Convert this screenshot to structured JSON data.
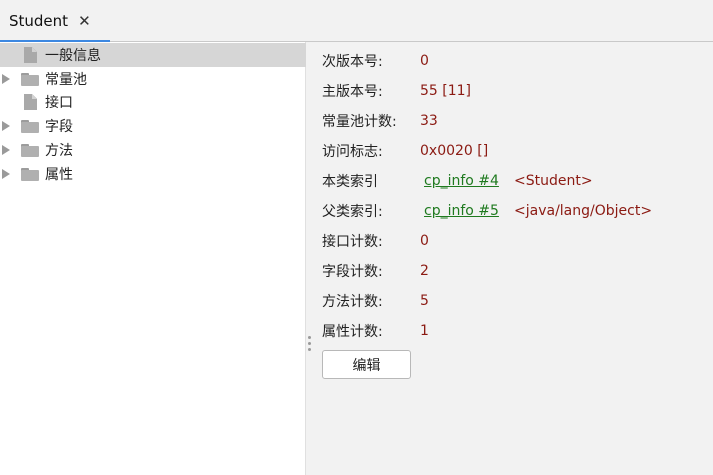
{
  "tab": {
    "title": "Student",
    "close_glyph": "✕"
  },
  "tree": {
    "items": [
      {
        "label": "一般信息",
        "icon": "file-icon",
        "expandable": false,
        "selected": true
      },
      {
        "label": "常量池",
        "icon": "folder-icon",
        "expandable": true,
        "selected": false
      },
      {
        "label": "接口",
        "icon": "file-icon",
        "expandable": false,
        "selected": false
      },
      {
        "label": "字段",
        "icon": "folder-icon",
        "expandable": true,
        "selected": false
      },
      {
        "label": "方法",
        "icon": "folder-icon",
        "expandable": true,
        "selected": false
      },
      {
        "label": "属性",
        "icon": "folder-icon",
        "expandable": true,
        "selected": false
      }
    ]
  },
  "details": {
    "minor_version": {
      "label": "次版本号:",
      "value": "0"
    },
    "major_version": {
      "label": "主版本号:",
      "value": "55 [11]"
    },
    "constant_pool_count": {
      "label": "常量池计数:",
      "value": "33"
    },
    "access_flags": {
      "label": "访问标志:",
      "value": "0x0020 []"
    },
    "this_class": {
      "label": "本类索引",
      "link": "cp_info #4",
      "ref": "<Student>"
    },
    "super_class": {
      "label": "父类索引:",
      "link": "cp_info #5",
      "ref": "<java/lang/Object>"
    },
    "interfaces_count": {
      "label": "接口计数:",
      "value": "0"
    },
    "fields_count": {
      "label": "字段计数:",
      "value": "2"
    },
    "methods_count": {
      "label": "方法计数:",
      "value": "5"
    },
    "attributes_count": {
      "label": "属性计数:",
      "value": "1"
    }
  },
  "edit_button": {
    "label": "编辑"
  },
  "colors": {
    "tab_accent": "#3d88e1",
    "value_text": "#8b1a12",
    "link_text": "#1f7a1f",
    "selected_row": "#d6d6d6"
  }
}
